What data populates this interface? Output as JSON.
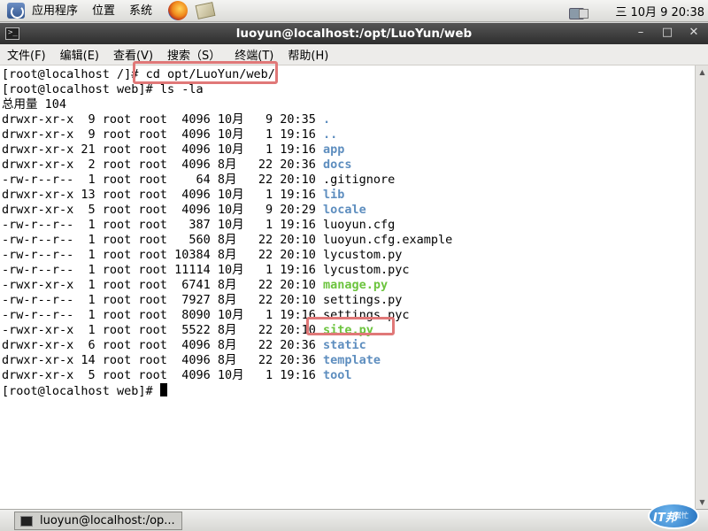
{
  "top_panel": {
    "menus": [
      "应用程序",
      "位置",
      "系统"
    ],
    "clock": "三 10月  9 20:38"
  },
  "window": {
    "title": "luoyun@localhost:/opt/LuoYun/web",
    "menus": [
      "文件(F)",
      "编辑(E)",
      "查看(V)",
      "搜索（S）",
      "终端(T)",
      "帮助(H)"
    ]
  },
  "terminal": {
    "lines": [
      {
        "prompt": "[root@localhost /]# ",
        "command": "cd opt/LuoYun/web/"
      },
      {
        "prompt": "[root@localhost web]# ",
        "command": "ls -la"
      },
      {
        "prompt": "",
        "command": "总用量 104"
      }
    ],
    "entries": [
      {
        "meta": "drwxr-xr-x  9 root root  4096 10月   9 20:35 ",
        "name": ".",
        "kind": "dir"
      },
      {
        "meta": "drwxr-xr-x  9 root root  4096 10月   1 19:16 ",
        "name": "..",
        "kind": "dir"
      },
      {
        "meta": "drwxr-xr-x 21 root root  4096 10月   1 19:16 ",
        "name": "app",
        "kind": "dir"
      },
      {
        "meta": "drwxr-xr-x  2 root root  4096 8月   22 20:36 ",
        "name": "docs",
        "kind": "dir"
      },
      {
        "meta": "-rw-r--r--  1 root root    64 8月   22 20:10 ",
        "name": ".gitignore",
        "kind": "file"
      },
      {
        "meta": "drwxr-xr-x 13 root root  4096 10月   1 19:16 ",
        "name": "lib",
        "kind": "dir"
      },
      {
        "meta": "drwxr-xr-x  5 root root  4096 10月   9 20:29 ",
        "name": "locale",
        "kind": "dir"
      },
      {
        "meta": "-rw-r--r--  1 root root   387 10月   1 19:16 ",
        "name": "luoyun.cfg",
        "kind": "file"
      },
      {
        "meta": "-rw-r--r--  1 root root   560 8月   22 20:10 ",
        "name": "luoyun.cfg.example",
        "kind": "file"
      },
      {
        "meta": "-rw-r--r--  1 root root 10384 8月   22 20:10 ",
        "name": "lycustom.py",
        "kind": "file"
      },
      {
        "meta": "-rw-r--r--  1 root root 11114 10月   1 19:16 ",
        "name": "lycustom.pyc",
        "kind": "file"
      },
      {
        "meta": "-rwxr-xr-x  1 root root  6741 8月   22 20:10 ",
        "name": "manage.py",
        "kind": "exe"
      },
      {
        "meta": "-rw-r--r--  1 root root  7927 8月   22 20:10 ",
        "name": "settings.py",
        "kind": "file"
      },
      {
        "meta": "-rw-r--r--  1 root root  8090 10月   1 19:16 ",
        "name": "settings.pyc",
        "kind": "file"
      },
      {
        "meta": "-rwxr-xr-x  1 root root  5522 8月   22 20:10 ",
        "name": "site.py",
        "kind": "exe"
      },
      {
        "meta": "drwxr-xr-x  6 root root  4096 8月   22 20:36 ",
        "name": "static",
        "kind": "dir"
      },
      {
        "meta": "drwxr-xr-x 14 root root  4096 8月   22 20:36 ",
        "name": "template",
        "kind": "dir"
      },
      {
        "meta": "drwxr-xr-x  5 root root  4096 10月   1 19:16 ",
        "name": "tool",
        "kind": "dir"
      }
    ],
    "final_prompt": "[root@localhost web]# "
  },
  "taskbar": {
    "task_label": "luoyun@localhost:/op..."
  },
  "watermark": {
    "text": "IT邦",
    "sub": "幫忙"
  },
  "colors": {
    "dir": "#5e8ebf",
    "exe": "#6cc43e",
    "highlight": "#e07878"
  }
}
